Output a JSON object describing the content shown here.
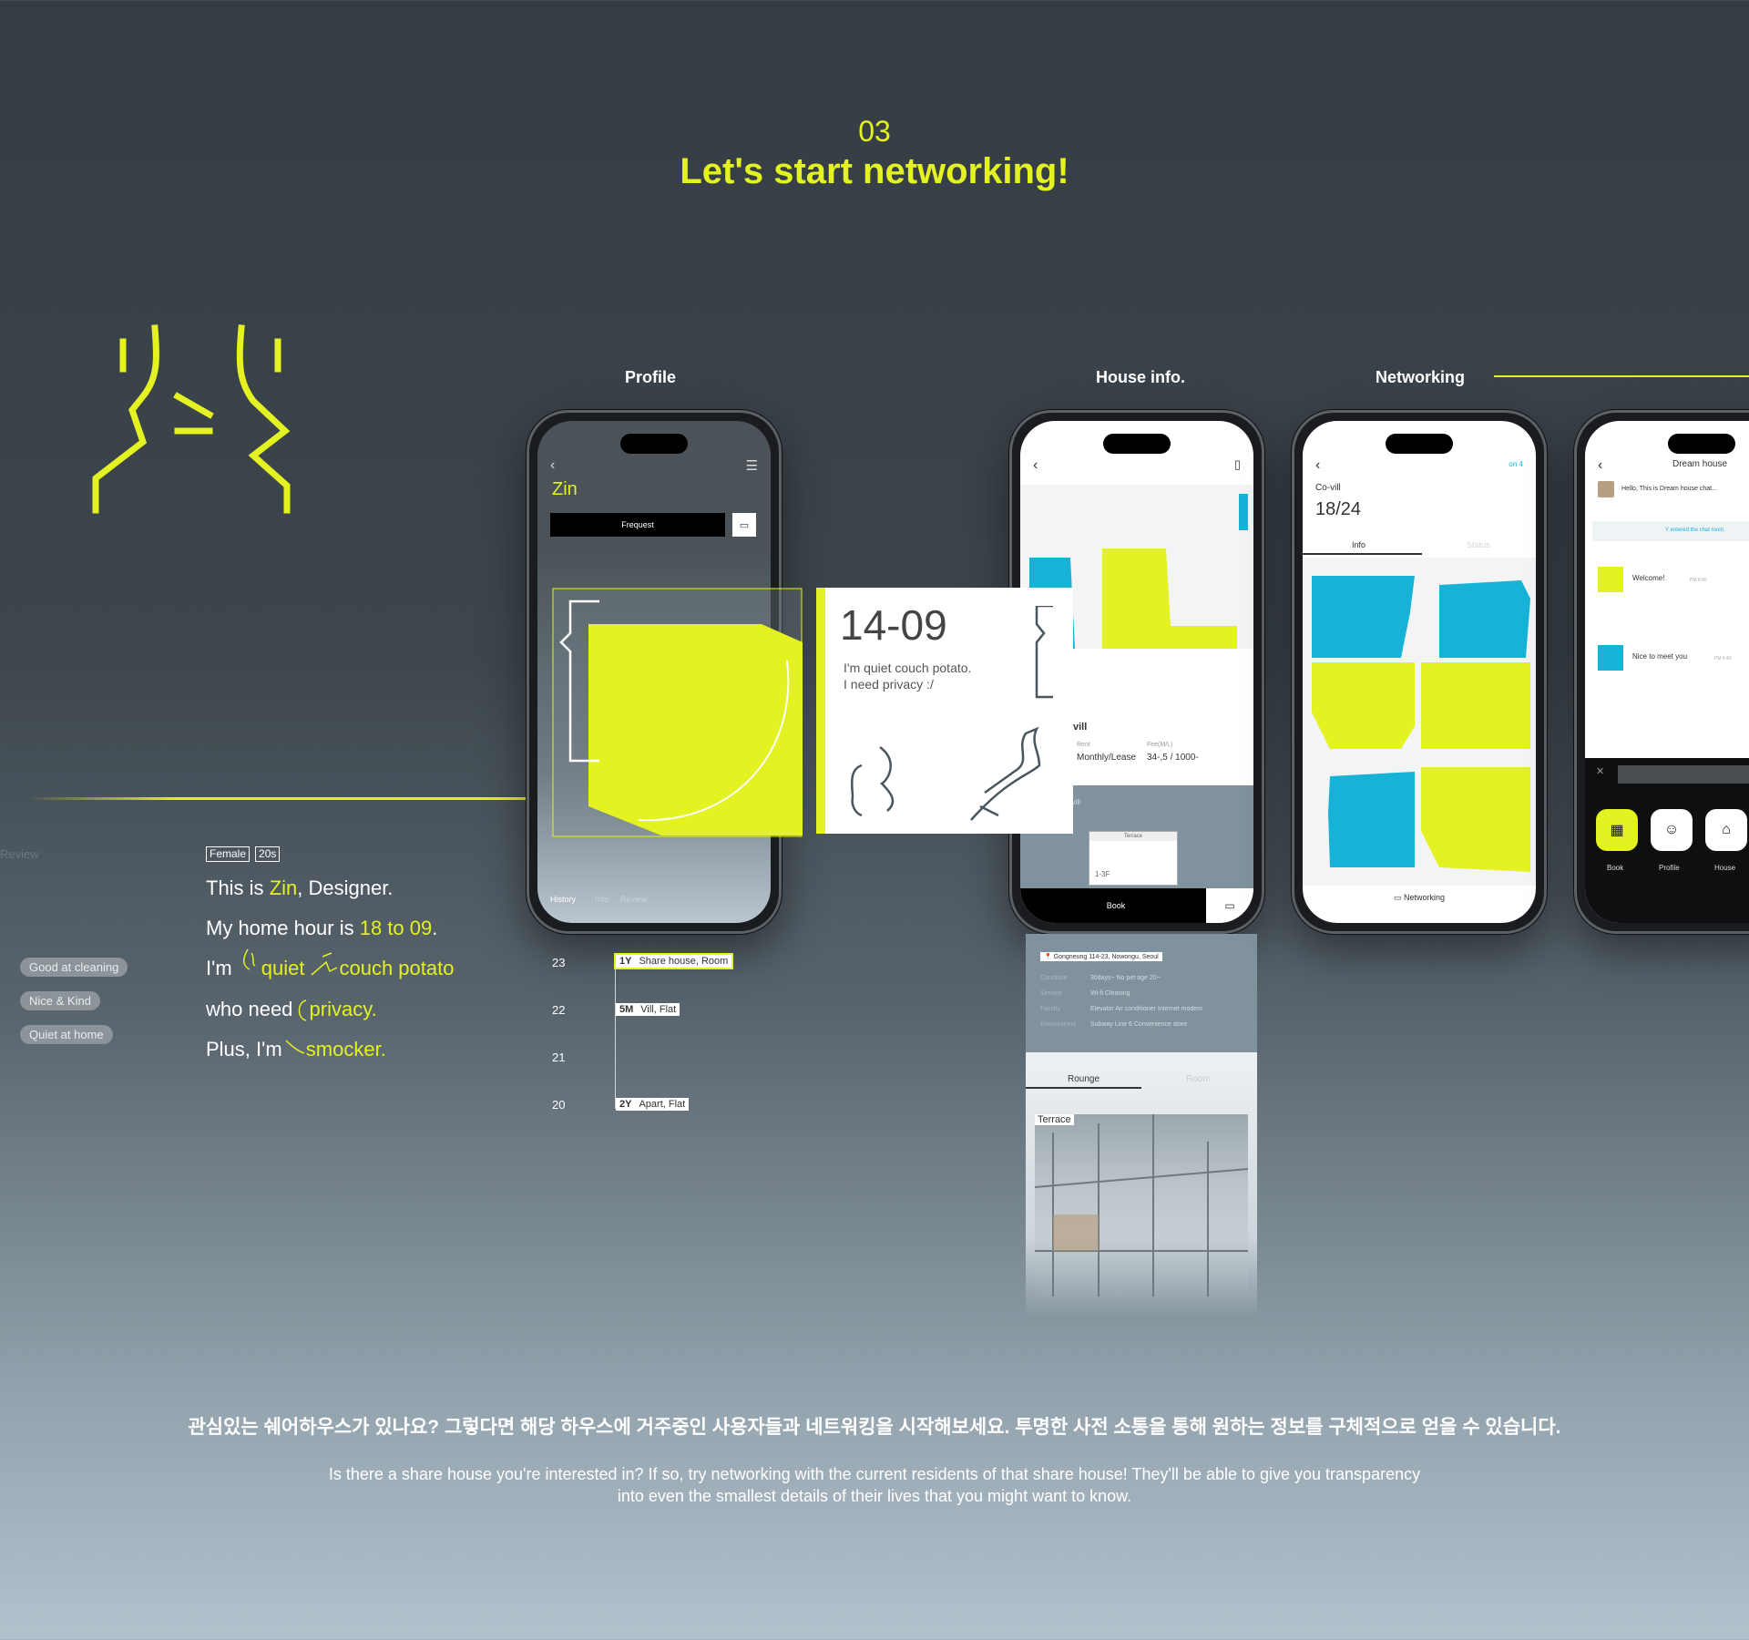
{
  "header": {
    "step": "03",
    "title": "Let's start networking!"
  },
  "section_labels": {
    "profile": "Profile",
    "house": "House info.",
    "networking": "Networking"
  },
  "left": {
    "review_label": "Review",
    "chips": [
      "Good at cleaning",
      "Nice & Kind",
      "Quiet at home"
    ]
  },
  "profile_card": {
    "tags": [
      "Female",
      "20s"
    ],
    "line1": {
      "pre": "This is ",
      "name": "Zin",
      "post": ", Designer."
    },
    "line2": {
      "pre": "My home hour is ",
      "hours": "18 to 09",
      "post": "."
    },
    "line3": {
      "pre": "I'm ",
      "a": "quiet",
      "b": "couch potato"
    },
    "line4": {
      "pre": "who need ",
      "a": "privacy."
    },
    "line5": {
      "pre": "Plus, I'm ",
      "a": "smocker."
    }
  },
  "phone_profile": {
    "name": "Zin",
    "button": "Frequest",
    "tabs": [
      "History",
      "Info",
      "Review"
    ]
  },
  "hour_card": {
    "hours": "14-09",
    "desc1": "I'm quiet couch potato.",
    "desc2": "I need privacy :/"
  },
  "timeline": [
    {
      "year": "23",
      "dur": "1Y",
      "type": "Share house, Room"
    },
    {
      "year": "22",
      "dur": "5M",
      "type": "Vill, Flat"
    },
    {
      "year": "21",
      "dur": "",
      "type": ""
    },
    {
      "year": "20",
      "dur": "2Y",
      "type": "Apart, Flat"
    }
  ],
  "phone_house": {
    "title_partial": "vill",
    "rent_label": "Rent",
    "rent_value": "Monthly/Lease",
    "fee_label": "Fee(M/L)",
    "fee_value": "34-,5 / 1000-",
    "partial_vill": "e vill",
    "terrace_label": "Terrace",
    "floor": "1-3F",
    "book": "Book"
  },
  "house_extended": {
    "address": "Gongneung 114-23, Nowongu, Seoul",
    "rows": [
      {
        "label": "Condition",
        "value": "30days~   No pet   age 20~"
      },
      {
        "label": "Service",
        "value": "Wi-fi   Cleaning"
      },
      {
        "label": "Facility",
        "value": "Elevator   Air conditioner   Internet modem"
      },
      {
        "label": "Environment",
        "value": "Subway Line 6   Convenience store"
      }
    ],
    "tabs": [
      "Rounge",
      "Room"
    ],
    "photo_label": "Terrace"
  },
  "phone_network": {
    "status": "on 4",
    "title": "Co-vill",
    "count": "18/24",
    "tabs": [
      "Info",
      "Status"
    ],
    "button": "Networking"
  },
  "phone_chat": {
    "title": "Dream house",
    "preview": "Hello, This is Dream house chat...",
    "entered": "Y entered the chat room",
    "msg1": "Welcome!",
    "msg2": "Nice to meet you",
    "time1": "PM 6:40",
    "time2": "PM 6:40",
    "actions": [
      "Book",
      "Profile",
      "House"
    ]
  },
  "footer": {
    "korean": "관심있는 쉐어하우스가 있나요? 그렇다면 해당 하우스에 거주중인 사용자들과 네트워킹을 시작해보세요. 투명한 사전 소통을 통해 원하는 정보를 구체적으로 얻을 수 있습니다.",
    "en1": "Is there a share house you're interested in? If so, try networking with the current residents of that share house!  They'll be able to give you transparency",
    "en2": "into even the smallest details of their lives that you might want to know."
  },
  "colors": {
    "accent": "#e4f221",
    "blue": "#17b3d6",
    "bg": "#353d44"
  }
}
